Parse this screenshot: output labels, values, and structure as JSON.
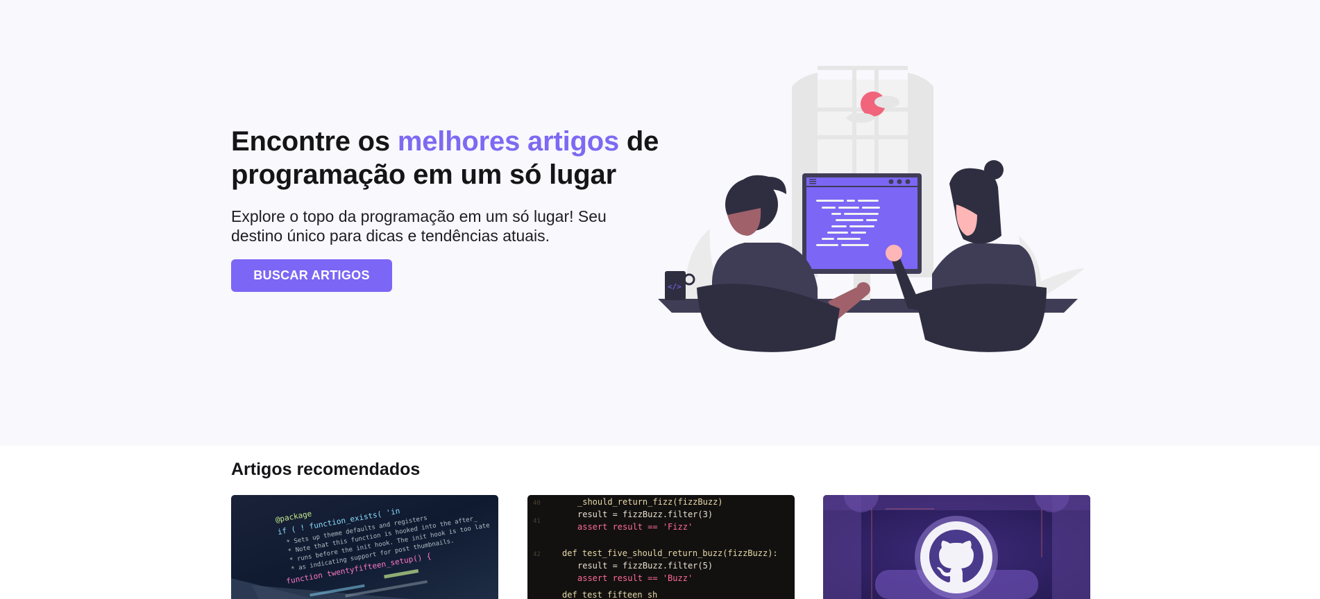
{
  "hero": {
    "title_part1": "Encontre os ",
    "title_accent": "melhores artigos",
    "title_part2": " de programação em um só lugar",
    "subtitle": "Explore o topo da programação em um só lugar! Seu destino único para dicas e tendências atuais.",
    "cta_label": "BUSCAR ARTIGOS",
    "illustration_icon": "developers-at-computer-illustration"
  },
  "recommended": {
    "title": "Artigos recomendados",
    "cards": [
      {
        "image": "code-editor-laptop-photo",
        "code_lines": [
          "@package",
          "if ( ! function_exists( 'in",
          "* Sets up theme defaults and registers",
          "* Note that this function is hooked into the after_",
          "* runs before the init hook. The init hook is too late",
          "* as indicating support for post thumbnails.",
          "function twentyfifteen_setup() {"
        ]
      },
      {
        "image": "code-snippet-dark-photo",
        "code_lines": [
          "_should_return_fizz(fizzBuzz)",
          "result = fizzBuzz.filter(3)",
          "assert result == 'Fizz'",
          "def test_five_should_return_buzz(fizzBuzz):",
          "result = fizzBuzz.filter(5)",
          "assert result == 'Buzz'",
          "def test_fifteen_sh"
        ]
      },
      {
        "image": "github-logo-banner",
        "icon": "github-octocat-icon"
      }
    ]
  },
  "colors": {
    "accent": "#7c66f5",
    "hero_background": "#f8f8fd",
    "text": "#151518"
  }
}
